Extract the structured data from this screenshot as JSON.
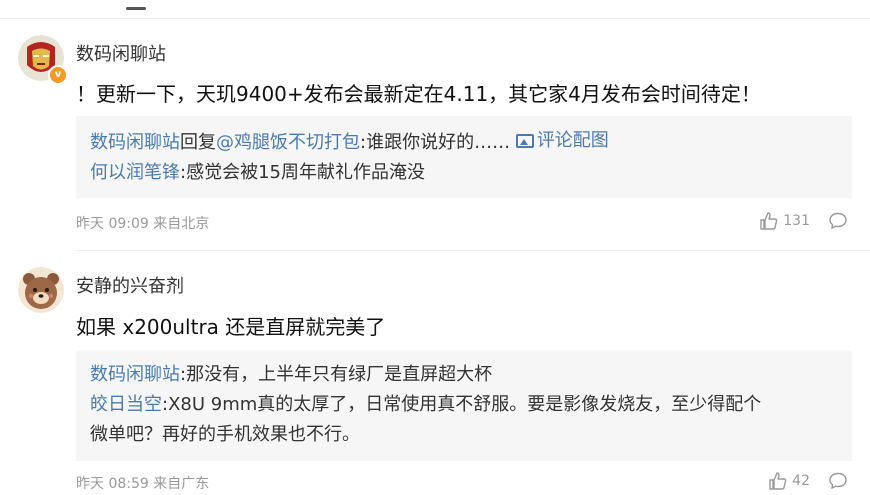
{
  "comments": [
    {
      "username": "数码闲聊站",
      "badge": "v",
      "content": "！更新一下，天玑9400+发布会最新定在4.11，其它家4月发布会时间待定！",
      "replies": [
        {
          "author": "数码闲聊站",
          "reply_word": "回复",
          "mention": "@鸡腿饭不切打包",
          "text": ":谁跟你说好的……",
          "image_link": "评论配图"
        },
        {
          "author": "何以润笔锋",
          "text": ":感觉会被15周年献礼作品淹没"
        }
      ],
      "meta": "昨天 09:09 来自北京",
      "likes": "131"
    },
    {
      "username": "安静的兴奋剂",
      "content": "如果 x200ultra 还是直屏就完美了",
      "replies": [
        {
          "author": "数码闲聊站",
          "text": ":那没有，上半年只有绿厂是直屏超大杯"
        },
        {
          "author": "皎日当空",
          "text": ":X8U 9mm真的太厚了，日常使用真不舒服。要是影像发烧友，至少得配个",
          "text2": "微单吧？再好的手机效果也不行。"
        }
      ],
      "meta": "昨天 08:59 来自广东",
      "likes": "42"
    }
  ],
  "colors": {
    "link": "#4a7bb0",
    "meta": "#999999",
    "reply_bg": "#f6f6f6",
    "badge": "#f59a23"
  },
  "icons": [
    "thumbs-up-icon",
    "comment-bubble-icon",
    "image-icon",
    "verified-badge-icon"
  ]
}
